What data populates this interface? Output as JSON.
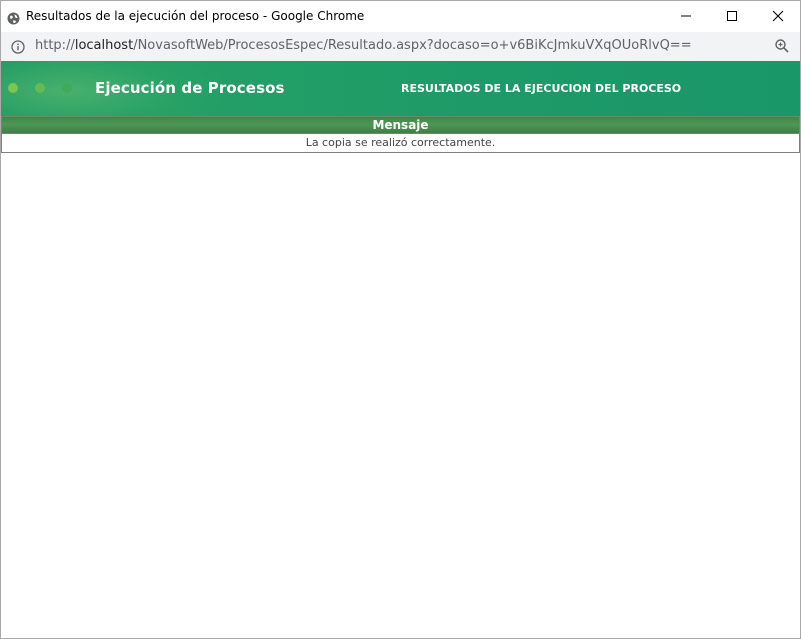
{
  "window": {
    "title": "Resultados de la ejecución del proceso - Google Chrome",
    "icons": {
      "app": "globe-icon",
      "minimize": "minimize-icon",
      "maximize": "maximize-icon",
      "close": "close-icon"
    }
  },
  "addressbar": {
    "info_icon": "info-icon",
    "url_scheme": "http://",
    "url_host": "localhost",
    "url_path": "/NovasoftWeb/ProcesosEspec/Resultado.aspx?docaso=o+v6BiKcJmkuVXqOUoRlvQ==",
    "zoom_icon": "zoom-icon"
  },
  "header": {
    "title": "Ejecución de Procesos",
    "heading": "RESULTADOS DE LA EJECUCION DEL PROCESO",
    "colors": {
      "banner": "#1f9a63",
      "dots": [
        "#7ac74f",
        "#62bc52",
        "#3fab5a"
      ]
    }
  },
  "results": {
    "column_header": "Mensaje",
    "rows": [
      {
        "message": "La copia se realizó correctamente."
      }
    ],
    "colors": {
      "header_bg": "#4f9656"
    }
  }
}
